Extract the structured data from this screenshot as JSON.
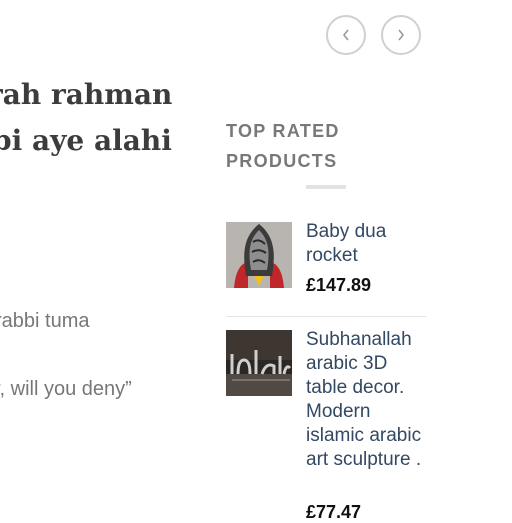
{
  "content": {
    "heading_lines": [
      "rah rahman",
      "bi aye alahi"
    ],
    "body_lines": [
      "rabbi tuma",
      "r, will you deny”"
    ]
  },
  "sidebar": {
    "title": "TOP RATED PRODUCTS",
    "products": [
      {
        "name": "Baby dua rocket",
        "price": "£147.89"
      },
      {
        "name": "Subhanallah arabic 3D table decor. Modern islamic arabic art sculpture .",
        "price": "£77.47"
      }
    ]
  },
  "icons": {
    "prev": "chevron-left-icon",
    "next": "chevron-right-icon"
  },
  "colors": {
    "link": "#334862",
    "heading": "#3c3c3c",
    "muted": "#777777"
  }
}
